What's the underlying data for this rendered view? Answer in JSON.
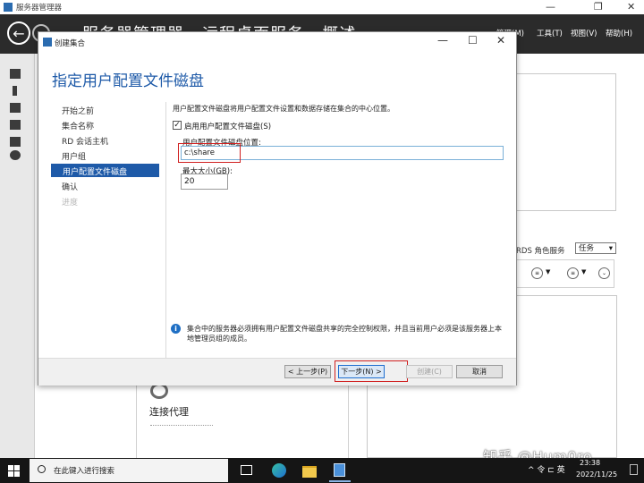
{
  "app": {
    "title": "服务器管理器",
    "breadcrumb": "服务器管理器 · 远程桌面服务 · 概述",
    "menus": [
      "管理(M)",
      "工具(T)",
      "视图(V)",
      "帮助(H)"
    ]
  },
  "background": {
    "rds_label": "RDS 角色服务",
    "tasks_label": "任务",
    "connection_broker": "连接代理"
  },
  "watermark": "知乎 @Hum0ro",
  "dialog": {
    "title": "创建集合",
    "heading": "指定用户配置文件磁盘",
    "steps": [
      "开始之前",
      "集合名称",
      "RD 会话主机",
      "用户组",
      "用户配置文件磁盘",
      "确认",
      "进度"
    ],
    "active_step": "用户配置文件磁盘",
    "description": "用户配置文件磁盘将用户配置文件设置和数据存储在集合的中心位置。",
    "enable_checkbox_label": "启用用户配置文件磁盘(S)",
    "enable_checked": true,
    "path_label": "用户配置文件磁盘位置:",
    "path_value": "c:\\share",
    "size_label": "最大大小(GB):",
    "size_value": "20",
    "info_text": "集合中的服务器必须拥有用户配置文件磁盘共享的完全控制权限，并且当前用户必须是该服务器上本地管理员组的成员。",
    "buttons": {
      "prev": "< 上一步(P)",
      "next": "下一步(N) >",
      "create": "创建(C)",
      "cancel": "取消"
    }
  },
  "taskbar": {
    "search_placeholder": "在此键入进行搜索",
    "tray_text": "^ 令 ⊏ 英",
    "time": "23:38",
    "date": "2022/11/25"
  },
  "colors": {
    "accent": "#1e5aa8",
    "header_bg": "#2b2b2b",
    "highlight": "#d02020"
  }
}
